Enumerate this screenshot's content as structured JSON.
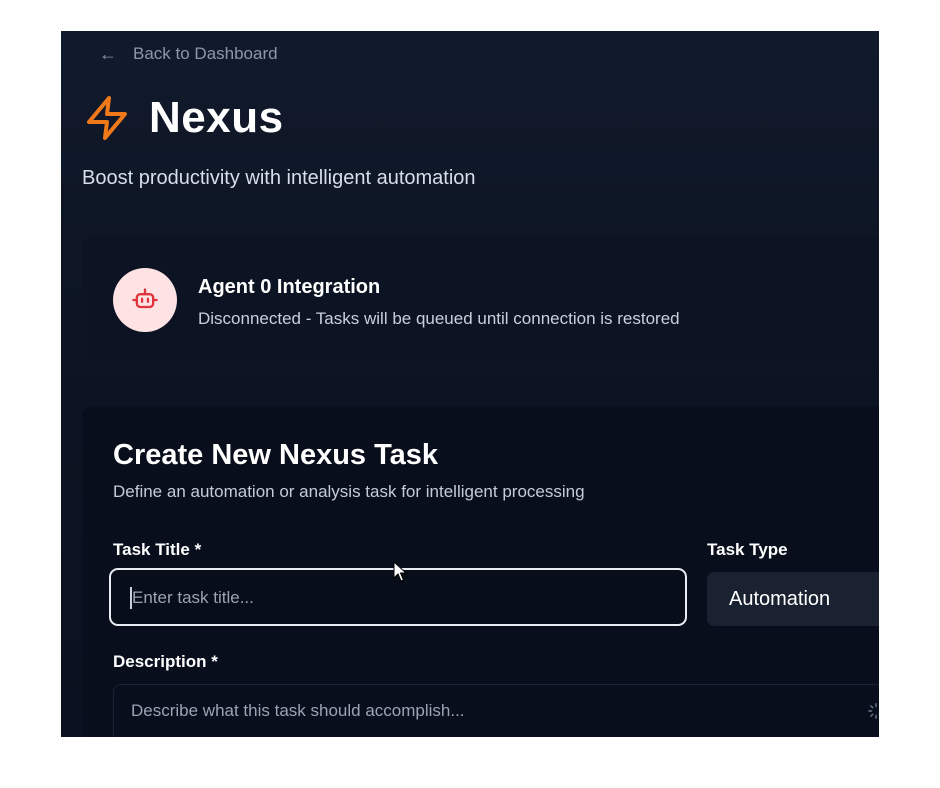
{
  "nav": {
    "back_label": "Back to Dashboard",
    "back_icon": "arrow-left-icon"
  },
  "brand": {
    "title": "Nexus",
    "icon": "lightning-bolt-icon",
    "accent": "#f07a1a"
  },
  "tagline": "Boost productivity with intelligent automation",
  "agent": {
    "title": "Agent 0 Integration",
    "status": "Disconnected - Tasks will be queued until connection is restored",
    "icon": "robot-icon",
    "icon_color": "#e0353d",
    "icon_bg": "#fde3e3"
  },
  "form": {
    "title": "Create New Nexus Task",
    "subtitle": "Define an automation or analysis task for intelligent processing",
    "task_title": {
      "label": "Task Title *",
      "placeholder": "Enter task title...",
      "value": ""
    },
    "task_type": {
      "label": "Task Type",
      "value": "Automation"
    },
    "description": {
      "label": "Description *",
      "placeholder": "Describe what this task should accomplish..."
    }
  }
}
